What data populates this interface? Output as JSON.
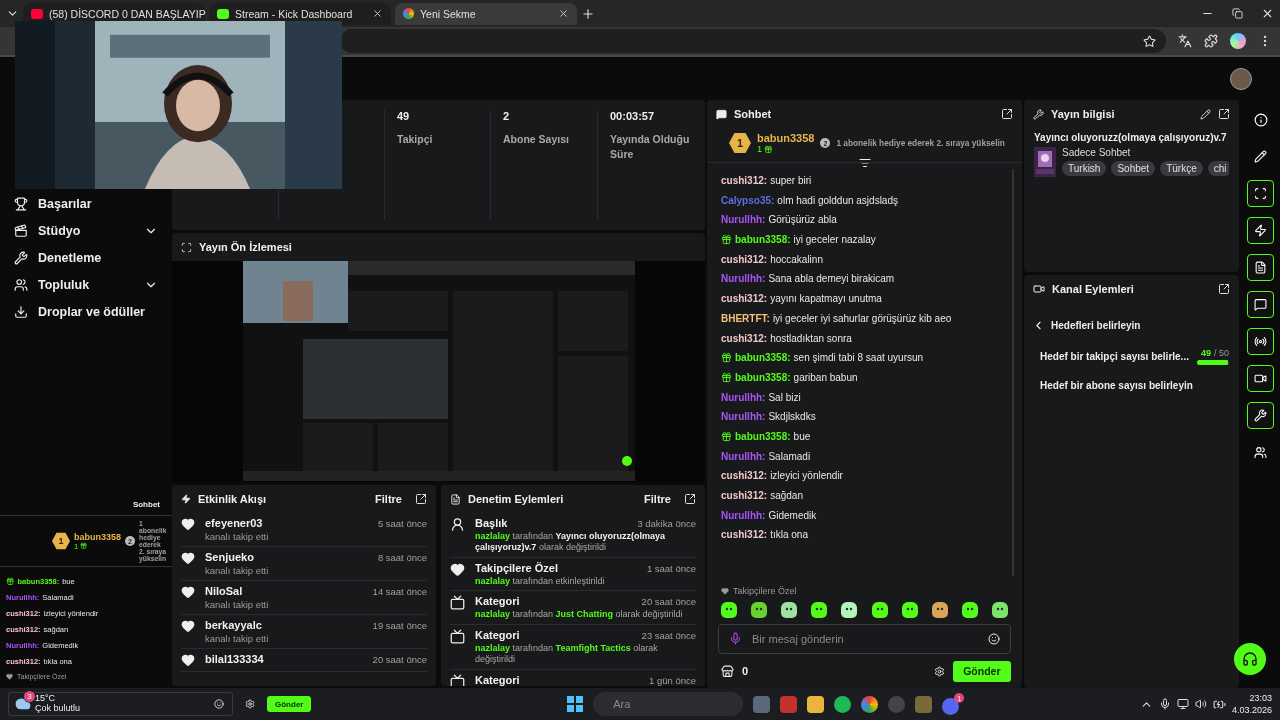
{
  "browser": {
    "tabs": [
      {
        "kind": "youtube",
        "title": "(58) DİSCORD 0 DAN BAŞLAYIP",
        "selected": false
      },
      {
        "kind": "kick",
        "title": "Stream - Kick Dashboard",
        "selected": false
      },
      {
        "kind": "chrome",
        "title": "Yeni Sekme",
        "selected": true
      }
    ]
  },
  "sidebar": {
    "items": [
      {
        "label": "Başarılar",
        "expandable": false
      },
      {
        "label": "Stüdyo",
        "expandable": true
      },
      {
        "label": "Denetleme",
        "expandable": false
      },
      {
        "label": "Topluluk",
        "expandable": true
      },
      {
        "label": "Droplar ve ödüller",
        "expandable": false
      }
    ]
  },
  "stats": [
    {
      "value": "49",
      "label": "Takipçi"
    },
    {
      "value": "2",
      "label": "Abone Sayısı"
    },
    {
      "value": "00:03:57",
      "label": "Yayında Olduğu Süre"
    }
  ],
  "preview": {
    "title": "Yayın Ön İzlemesi"
  },
  "event_feed": {
    "title": "Etkinlik Akışı",
    "filter": "Filtre",
    "items": [
      {
        "name": "efeyener03",
        "action": "kanalı takip etti",
        "time": "5 saat önce"
      },
      {
        "name": "Senjueko",
        "action": "kanalı takip etti",
        "time": "8 saat önce"
      },
      {
        "name": "NiloSal",
        "action": "kanalı takip etti",
        "time": "14 saat önce"
      },
      {
        "name": "berkayyalc",
        "action": "kanalı takip etti",
        "time": "19 saat önce"
      },
      {
        "name": "bilal133334",
        "time": "20 saat önce"
      }
    ]
  },
  "audit": {
    "title": "Denetim Eylemleri",
    "filter": "Filtre",
    "items": [
      {
        "kind": "person",
        "title": "Başlık",
        "time": "3 dakika önce",
        "parts": [
          {
            "text": "nazlalay",
            "kind": "actor"
          },
          {
            "text": " tarafından ",
            "kind": "plain"
          },
          {
            "text": "Yayıncı oluyoruzz(olmaya çalışıyoruz)v.7",
            "kind": "value"
          },
          {
            "text": " olarak değiştirildi",
            "kind": "plain"
          }
        ]
      },
      {
        "kind": "heart",
        "title": "Takipçilere Özel",
        "time": "1 saat önce",
        "parts": [
          {
            "text": "nazlalay",
            "kind": "actor"
          },
          {
            "text": " tarafından etkinleştirildi",
            "kind": "plain"
          }
        ]
      },
      {
        "kind": "category",
        "title": "Kategori",
        "time": "20 saat önce",
        "parts": [
          {
            "text": "nazlalay",
            "kind": "actor"
          },
          {
            "text": " tarafından ",
            "kind": "plain"
          },
          {
            "text": "Just Chatting",
            "kind": "category"
          },
          {
            "text": " olarak değiştirildi",
            "kind": "plain"
          }
        ]
      },
      {
        "kind": "category",
        "title": "Kategori",
        "time": "23 saat önce",
        "parts": [
          {
            "text": "nazlalay",
            "kind": "actor"
          },
          {
            "text": " tarafından ",
            "kind": "plain"
          },
          {
            "text": "Teamfight Tactics",
            "kind": "category"
          },
          {
            "text": " olarak değiştirildi",
            "kind": "plain"
          }
        ]
      },
      {
        "kind": "category",
        "title": "Kategori",
        "time": "1 gün önce"
      }
    ]
  },
  "chat": {
    "title": "Sohbet",
    "pinned": {
      "rank": "1",
      "user": "babun3358",
      "count": "1",
      "next_rank": "2",
      "message": "1 abonelik hediye ederek 2. sıraya yükselin"
    },
    "messages": [
      {
        "user": "cushi312:",
        "color": "#f3c6c9",
        "gift": false,
        "text": "super biri"
      },
      {
        "user": "Calypso35:",
        "color": "#5b6fe0",
        "gift": false,
        "text": "olm hadi golddun asjdsladş"
      },
      {
        "user": "Nurullhh:",
        "color": "#a855f7",
        "gift": false,
        "text": "Görüşürüz abla"
      },
      {
        "user": "babun3358:",
        "color": "#53fc18",
        "gift": true,
        "text": "iyi geceler nazalay"
      },
      {
        "user": "cushi312:",
        "color": "#f3c6c9",
        "gift": false,
        "text": "hoccakalinn"
      },
      {
        "user": "Nurullhh:",
        "color": "#a855f7",
        "gift": false,
        "text": "Sana abla demeyi birakicam"
      },
      {
        "user": "cushi312:",
        "color": "#f3c6c9",
        "gift": false,
        "text": "yayını kapatmayı unutma"
      },
      {
        "user": "BHERTFT:",
        "color": "#f5c27a",
        "gift": false,
        "text": "iyi geceler iyi sahurlar görüşürüz kib aeo"
      },
      {
        "user": "cushi312:",
        "color": "#f3c6c9",
        "gift": false,
        "text": "hostladıktan sonra"
      },
      {
        "user": "babun3358:",
        "color": "#53fc18",
        "gift": true,
        "text": "sen şimdi tabi 8 saat uyursun"
      },
      {
        "user": "babun3358:",
        "color": "#53fc18",
        "gift": true,
        "text": "gariban babun"
      },
      {
        "user": "Nurullhh:",
        "color": "#a855f7",
        "gift": false,
        "text": "Sal bizi"
      },
      {
        "user": "Nurullhh:",
        "color": "#a855f7",
        "gift": false,
        "text": "Skdjlskdks"
      },
      {
        "user": "babun3358:",
        "color": "#53fc18",
        "gift": true,
        "text": "bue"
      },
      {
        "user": "Nurullhh:",
        "color": "#a855f7",
        "gift": false,
        "text": "Salamadi"
      },
      {
        "user": "cushi312:",
        "color": "#f3c6c9",
        "gift": false,
        "text": "izleyici yönlendir"
      },
      {
        "user": "cushi312:",
        "color": "#f3c6c9",
        "gift": false,
        "text": "sağdan"
      },
      {
        "user": "Nurullhh:",
        "color": "#a855f7",
        "gift": false,
        "text": "Gidemedik"
      },
      {
        "user": "cushi312:",
        "color": "#f3c6c9",
        "gift": false,
        "text": "tıkla ona"
      }
    ],
    "followers_only": "Takipçilere Özel",
    "input": {
      "placeholder": "Bir mesaj gönderin"
    },
    "points": "0",
    "send": "Gönder"
  },
  "stream_info": {
    "title": "Yayın bilgisi",
    "stream_title": "Yayıncı oluyoruzz(olmaya çalışıyoruz)v.7",
    "category": "Sadece Sohbet",
    "tags": [
      "Turkish",
      "Sohbet",
      "Türkçe",
      "chi"
    ]
  },
  "channel_actions": {
    "title": "Kanal Eylemleri",
    "back": "Hedefleri belirleyin",
    "goals": [
      {
        "label": "Hedef bir takipçi sayısı belirle...",
        "progress": {
          "current": "49",
          "total": "/ 50",
          "level": 0.98
        }
      },
      {
        "label": "Hedef bir abone sayısı belirleyin"
      }
    ]
  },
  "mini_chat": {
    "title": "Sohbet",
    "pinned": {
      "rank": "1",
      "user": "babun3358",
      "count": "1",
      "next_rank": "2",
      "message": "1 abonelik hediye ederek 2. sıraya yükselin"
    },
    "messages": [
      {
        "user": "babun3358:",
        "color": "#53fc18",
        "gift": true,
        "text": "bue"
      },
      {
        "user": "Nurullhh:",
        "color": "#a855f7",
        "gift": false,
        "text": "Salamadi"
      },
      {
        "user": "cushi312:",
        "color": "#f3c6c9",
        "gift": false,
        "text": "izleyici yönlendir"
      },
      {
        "user": "cushi312:",
        "color": "#f3c6c9",
        "gift": false,
        "text": "sağdan"
      },
      {
        "user": "Nurullhh:",
        "color": "#a855f7",
        "gift": false,
        "text": "Gidemedik"
      },
      {
        "user": "cushi312:",
        "color": "#f3c6c9",
        "gift": false,
        "text": "tıkla ona"
      }
    ],
    "followers_only": "Takipçilere Özel",
    "send": "Gönder"
  },
  "taskbar": {
    "weather": {
      "badge": "3",
      "temp": "15°C",
      "condition": "Çok bulutlu"
    },
    "search": {
      "placeholder": "Ara"
    },
    "discord_badge": "1",
    "time": "23:03",
    "date": "4.03.2026"
  }
}
